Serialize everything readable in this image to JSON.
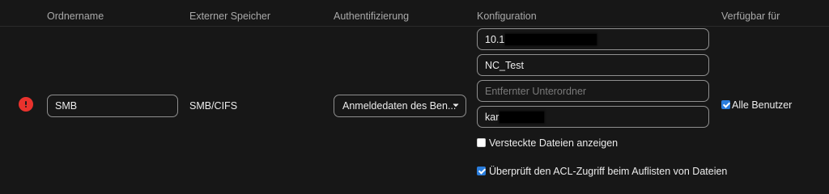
{
  "headers": {
    "folder_name": "Ordnername",
    "external_storage": "Externer Speicher",
    "authentication": "Authentifizierung",
    "configuration": "Konfiguration",
    "available_for": "Verfügbar für"
  },
  "row": {
    "status_icon": "error-exclamation-icon",
    "status_color": "#e9322d",
    "folder_name_value": "SMB",
    "external_storage_value": "SMB/CIFS",
    "authentication_selected": "Anmeldedaten des Ben...",
    "config": {
      "host_value": "10.1",
      "share_value": "NC_Test",
      "subfolder_placeholder": "Entfernter Unterordner",
      "domain_value": "kar"
    },
    "show_hidden_files_label": "Versteckte Dateien anzeigen",
    "show_hidden_files_checked": false,
    "check_acl_label": "Überprüft den ACL-Zugriff beim Auflisten von Dateien",
    "check_acl_checked": true,
    "all_users_label": "Alle Benutzer",
    "all_users_checked": true
  },
  "colors": {
    "background": "#171717",
    "accent": "#2a7ddc",
    "header_text": "#a9a9a9",
    "border": "#8f8f8f"
  }
}
